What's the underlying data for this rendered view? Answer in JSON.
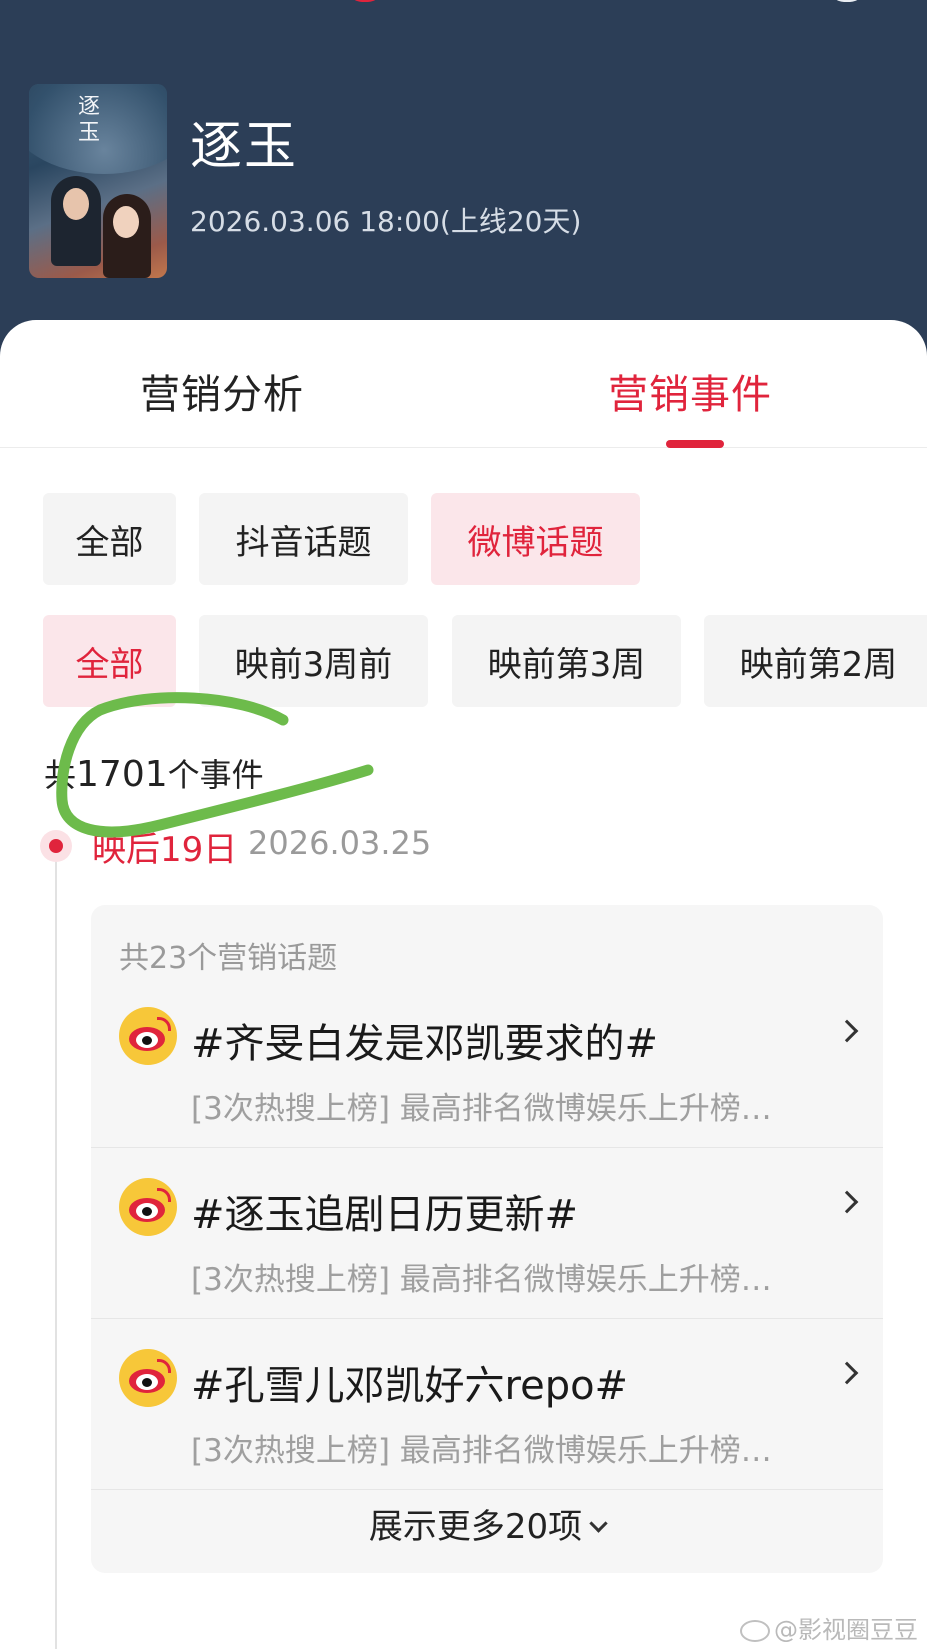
{
  "header": {
    "poster_title": "逐玉",
    "title": "逐玉",
    "release": "2026.03.06 18:00(上线20天)"
  },
  "tabs": [
    {
      "label": "营销分析",
      "active": false
    },
    {
      "label": "营销事件",
      "active": true
    }
  ],
  "platform_filters": [
    {
      "label": "全部",
      "active": false
    },
    {
      "label": "抖音话题",
      "active": false
    },
    {
      "label": "微博话题",
      "active": true
    }
  ],
  "period_filters": [
    {
      "label": "全部",
      "active": true
    },
    {
      "label": "映前3周前",
      "active": false
    },
    {
      "label": "映前第3周",
      "active": false
    },
    {
      "label": "映前第2周",
      "active": false
    }
  ],
  "event_count": {
    "prefix": "共",
    "count": "1701",
    "suffix": "个事件"
  },
  "timeline": {
    "day_label": "映后19日",
    "date": "2026.03.25",
    "panel_header": "共23个营销话题",
    "topics": [
      {
        "title": "#齐旻白发是邓凯要求的#",
        "subtitle": "[3次热搜上榜] 最高排名微博娱乐上升榜…"
      },
      {
        "title": "#逐玉追剧日历更新#",
        "subtitle": "[3次热搜上榜] 最高排名微博娱乐上升榜…"
      },
      {
        "title": "#孔雪儿邓凯好六repo#",
        "subtitle": "[3次热搜上榜] 最高排名微博娱乐上升榜…"
      }
    ],
    "show_more": "展示更多20项"
  },
  "watermark": "@影视圈豆豆",
  "colors": {
    "accent": "#e0243c",
    "header_bg": "#2c3e57",
    "annotation": "#6dbb4b"
  }
}
